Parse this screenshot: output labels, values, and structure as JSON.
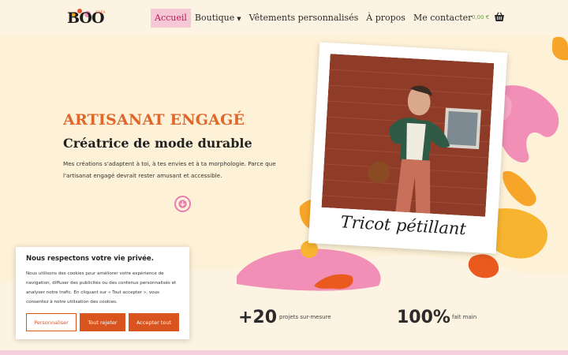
{
  "header": {
    "logo_text": "BOO",
    "logo_sub": "CRÉA",
    "nav": [
      {
        "label": "Accueil",
        "active": true
      },
      {
        "label": "Boutique",
        "has_dropdown": true
      },
      {
        "label": "Vêtements personnalisés"
      },
      {
        "label": "À propos"
      },
      {
        "label": "Me contacter"
      }
    ],
    "cart_amount": "0,00 €",
    "cart_icon": "basket-icon"
  },
  "hero": {
    "kicker": "ARTISANAT ENGAGÉ",
    "title": "Créatrice de mode durable",
    "description": "Mes créations s'adaptent à toi, à tes envies et à ta morphologie. Parce que l'artisanat engagé devrait rester amusant et accessible.",
    "scroll_icon": "arrow-down-circle-icon",
    "photo_caption": "Tricot pétillant"
  },
  "stats": [
    {
      "value": "+20",
      "label": "projets sur-mesure"
    },
    {
      "value": "100%",
      "label": "fait main"
    }
  ],
  "cookie": {
    "title": "Nous respectons votre vie privée.",
    "text": "Nous utilisons des cookies pour améliorer votre expérience de navigation, diffuser des publicités ou des contenus personnalisés et analyser notre trafic. En cliquant sur « Tout accepter », vous consentez à notre utilisation des cookies.",
    "buttons": {
      "customize": "Personnaliser",
      "reject": "Tout rejeter",
      "accept": "Accepter tout"
    }
  },
  "colors": {
    "background": "#fdf1d7",
    "header": "#fdf3e2",
    "accent_orange": "#e0662a",
    "button_orange": "#d9541e",
    "pink": "#f28fb6",
    "yellow": "#f7b431"
  }
}
